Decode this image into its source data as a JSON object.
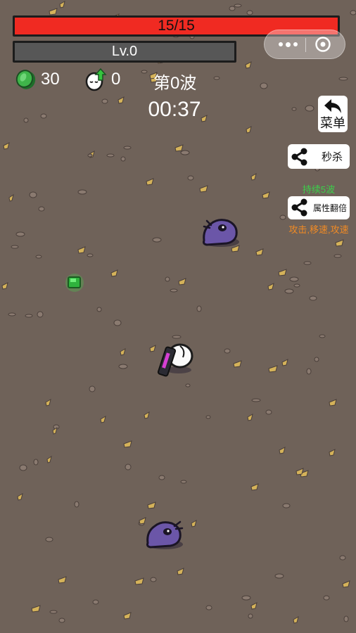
{
  "hud": {
    "health_text": "15/15",
    "health_current": 15,
    "health_max": 15,
    "level_text": "Lv.0",
    "experience_fraction": 0,
    "coins": "30",
    "eggs": "0",
    "wave": "第0波",
    "timer": "00:37"
  },
  "side_buttons": {
    "menu": "菜单",
    "instant_kill": "秒杀",
    "duration_note": "持续5波",
    "attribute_double": "属性翻倍",
    "attribute_note": "攻击,移速,攻速"
  },
  "icons": [
    "more-dot-icon",
    "close-icon",
    "green-coin-icon",
    "egg-upgrade-icon",
    "back-arrow-icon",
    "share-icon"
  ],
  "colors": {
    "health": "#f02a22",
    "experience": "#575757",
    "ground": "#6f6259",
    "note_green": "#3bd04a",
    "note_orange": "#f08a24",
    "enemy": "#6b56a8"
  }
}
